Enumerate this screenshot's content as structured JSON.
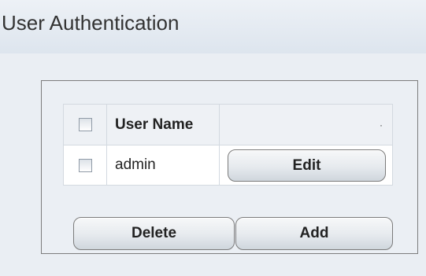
{
  "page": {
    "title": "User Authentication"
  },
  "table": {
    "columns": [
      "",
      "User Name",
      ""
    ],
    "header_mark": "·",
    "rows": [
      {
        "checked": false,
        "user_name": "admin",
        "action_label": "Edit"
      }
    ]
  },
  "actions": {
    "delete_label": "Delete",
    "add_label": "Add"
  },
  "colors": {
    "header_background": "#e4eaf1",
    "panel_background": "#ebeff4",
    "panel_border": "#7d7d7d",
    "button_border": "#7b7b7b"
  }
}
